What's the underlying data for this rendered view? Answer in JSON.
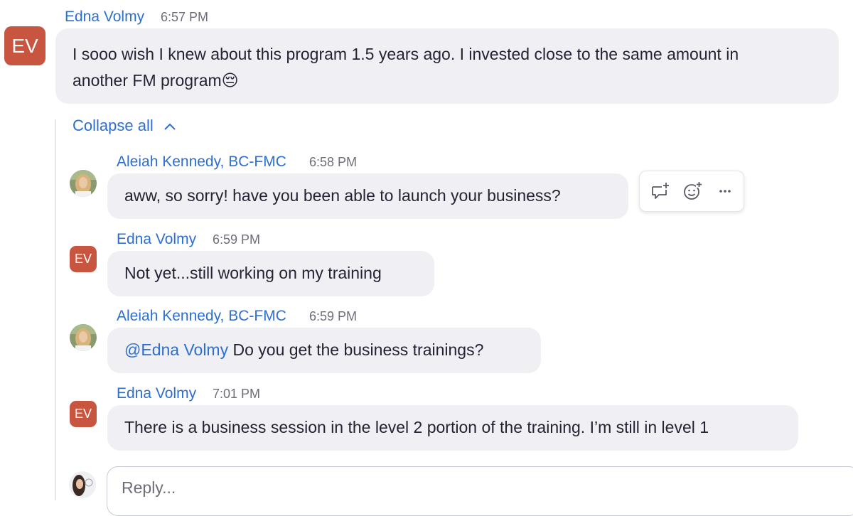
{
  "messages": [
    {
      "author": "Edna Volmy",
      "time": "6:57 PM",
      "avatar_initials": "EV",
      "text_line1": "I sooo wish I knew about this program 1.5 years ago. I invested close to the same amount in",
      "text_line2": "another FM program",
      "emoji": "😔"
    }
  ],
  "thread": {
    "collapse_label": "Collapse all",
    "replies": [
      {
        "author": "Aleiah Kennedy, BC-FMC",
        "time": "6:58 PM",
        "text": "aww, so sorry! have you been able to launch your business?"
      },
      {
        "author": "Edna Volmy",
        "time": "6:59 PM",
        "avatar_initials": "EV",
        "text": "Not yet...still working on my training"
      },
      {
        "author": "Aleiah Kennedy, BC-FMC",
        "time": "6:59 PM",
        "mention": "@Edna Volmy",
        "text": " Do you get the business trainings?"
      },
      {
        "author": "Edna Volmy",
        "time": "7:01 PM",
        "avatar_initials": "EV",
        "text": "There is a business session in the level 2 portion of the training. I’m still in level 1"
      }
    ]
  },
  "hover_actions": [
    "reply-in-thread-icon",
    "add-reaction-icon",
    "more-options-icon"
  ],
  "reply_input": {
    "placeholder": "Reply..."
  },
  "colors": {
    "name_blue": "#2d6fd0",
    "avatar_red": "#c8553f",
    "bubble_bg": "#f0f0f4"
  }
}
